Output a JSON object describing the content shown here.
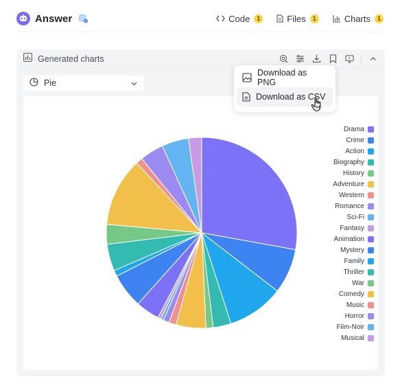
{
  "header": {
    "title": "Answer",
    "nav": [
      {
        "label": "Code",
        "count": "1",
        "icon": "code-icon"
      },
      {
        "label": "Files",
        "count": "1",
        "icon": "file-icon"
      },
      {
        "label": "Charts",
        "count": "1",
        "icon": "bar-chart-icon"
      }
    ]
  },
  "panel": {
    "title": "Generated charts",
    "chart_type_select": "Pie"
  },
  "menu": {
    "items": [
      {
        "label": "Download as PNG",
        "icon": "image-icon"
      },
      {
        "label": "Download as CSV",
        "icon": "document-icon"
      }
    ],
    "hovered_index": 1
  },
  "chart_data": {
    "type": "pie",
    "categories": [
      "Drama",
      "Crime",
      "Action",
      "Biography",
      "History",
      "Adventure",
      "Western",
      "Romance",
      "Sci-Fi",
      "Fantasy",
      "Animation",
      "Mystery",
      "Family",
      "Thriller",
      "War",
      "Comedy",
      "Music",
      "Horror",
      "Film-Noir",
      "Musical"
    ],
    "values": [
      27.5,
      7.5,
      9.5,
      3.0,
      1.2,
      11.5,
      1.1,
      4.0,
      4.5,
      2.2,
      4.0,
      5.8,
      1.0,
      4.5,
      3.3,
      5.0,
      1.2,
      1.0,
      0.5,
      0.5
    ],
    "colors": [
      "#7b72f7",
      "#3d84f2",
      "#1fa6ec",
      "#33bbb2",
      "#76c887",
      "#f2c04a",
      "#ef908a",
      "#9b8af0",
      "#63b4f0",
      "#c79be6",
      "#7b72f7",
      "#3d84f2",
      "#1fa6ec",
      "#33bbb2",
      "#76c887",
      "#f2c04a",
      "#ef908a",
      "#9b8af0",
      "#63b4f0",
      "#c79be6"
    ],
    "order_rendered": [
      0,
      1,
      2,
      3,
      4,
      15,
      16,
      17,
      18,
      19,
      10,
      11,
      12,
      13,
      14,
      5,
      6,
      7,
      8,
      9
    ],
    "legend_placement": "right"
  }
}
